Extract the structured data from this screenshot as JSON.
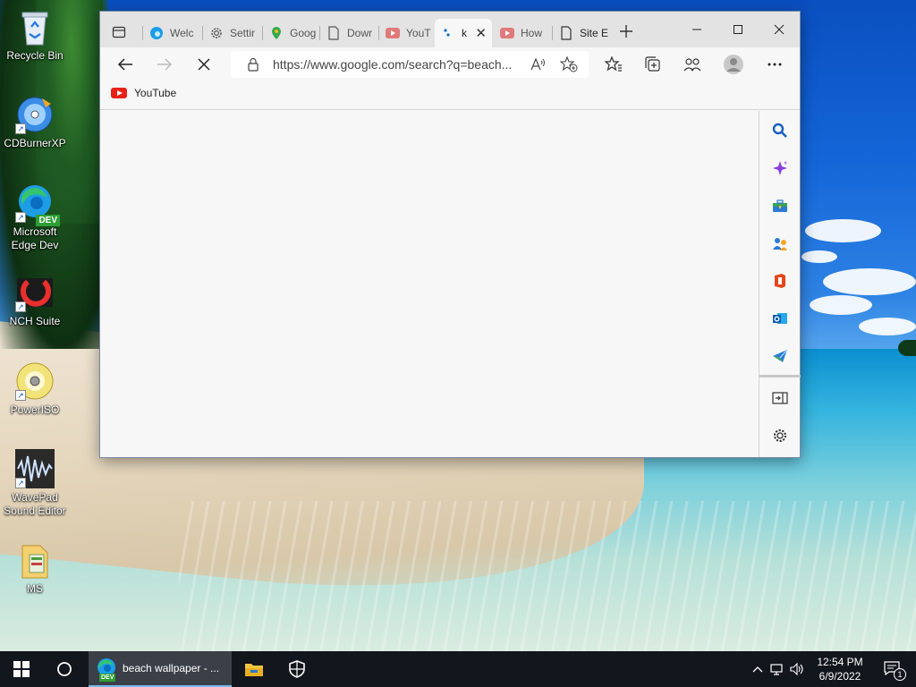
{
  "desktop": {
    "icons": [
      {
        "label": "Recycle Bin",
        "icon": "recycle-bin-icon"
      },
      {
        "label": "CDBurnerXP",
        "icon": "cdburner-icon"
      },
      {
        "label": "Microsoft Edge Dev",
        "label_line1": "Microsoft",
        "label_line2": "Edge Dev",
        "icon": "edge-dev-icon",
        "badge": "DEV"
      },
      {
        "label": "NCH Suite",
        "icon": "nch-suite-icon"
      },
      {
        "label": "PowerISO",
        "icon": "poweriso-icon"
      },
      {
        "label": "WavePad Sound Editor",
        "label_line1": "WavePad",
        "label_line2": "Sound Editor",
        "icon": "wavepad-icon"
      },
      {
        "label": "MS",
        "icon": "folder-icon"
      }
    ]
  },
  "browser": {
    "tabs": [
      {
        "label": "Welc",
        "icon": "edge-icon"
      },
      {
        "label": "Settir",
        "icon": "gear-icon"
      },
      {
        "label": "Goog",
        "icon": "maps-pin-icon"
      },
      {
        "label": "Dowr",
        "icon": "page-icon"
      },
      {
        "label": "YouT",
        "icon": "youtube-icon"
      },
      {
        "label": "k",
        "icon": "loading-icon",
        "active": true
      },
      {
        "label": "How",
        "icon": "youtube-icon"
      },
      {
        "label": "Site E",
        "icon": "page-icon"
      }
    ],
    "address": {
      "url": "https://www.google.com/search?q=beach..."
    },
    "favorites": [
      {
        "label": "YouTube",
        "icon": "youtube-icon"
      }
    ],
    "sidebar": [
      "search-icon",
      "sparkle-icon",
      "toolbox-icon",
      "people-icon",
      "office-icon",
      "outlook-icon",
      "send-icon",
      "open-pane-icon",
      "gear-icon"
    ]
  },
  "taskbar": {
    "app_label": "beach wallpaper - ...",
    "app_badge": "DEV",
    "time": "12:54 PM",
    "date": "6/9/2022",
    "notification_count": "1"
  },
  "colors": {
    "taskbar": "#12161d",
    "accent": "#76b9ed",
    "tab_bar": "#e3e3e3",
    "youtube_red": "#e62117"
  }
}
